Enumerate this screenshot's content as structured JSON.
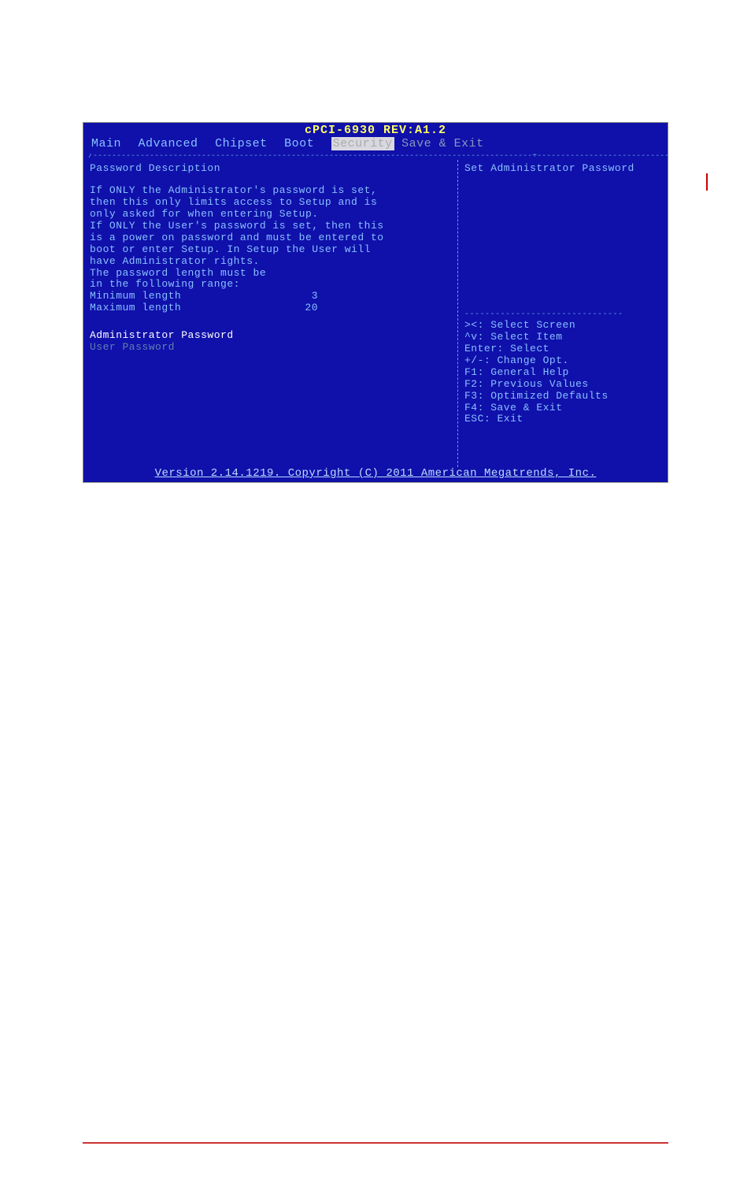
{
  "header": {
    "title": "cPCI-6930 REV:A1.2"
  },
  "menu": {
    "items": [
      "Main",
      "Advanced",
      "Chipset",
      "Boot",
      "Security",
      "Save & Exit"
    ],
    "active_index": 4
  },
  "left": {
    "section_title": "Password Description",
    "body_lines": [
      "If ONLY the Administrator's password is set,",
      "then this only limits access to Setup and is",
      "only asked for when entering Setup.",
      "If ONLY the User's password is set, then this",
      "is a power on password and must be entered to",
      "boot or enter Setup. In Setup the User will",
      "have Administrator rights.",
      "The password length must be",
      "in the following range:"
    ],
    "min_label": "Minimum length",
    "min_value": "3",
    "max_label": "Maximum length",
    "max_value": "20",
    "admin_pw": "Administrator Password",
    "user_pw": "User Password"
  },
  "right": {
    "help_title": "Set Administrator Password",
    "hints": [
      "><: Select Screen",
      "^v: Select Item",
      "Enter: Select",
      "+/-: Change Opt.",
      "F1: General Help",
      "F2: Previous Values",
      "F3: Optimized Defaults",
      "F4: Save & Exit",
      "ESC: Exit"
    ]
  },
  "footer": {
    "text": "Version 2.14.1219. Copyright (C) 2011 American Megatrends, Inc."
  }
}
